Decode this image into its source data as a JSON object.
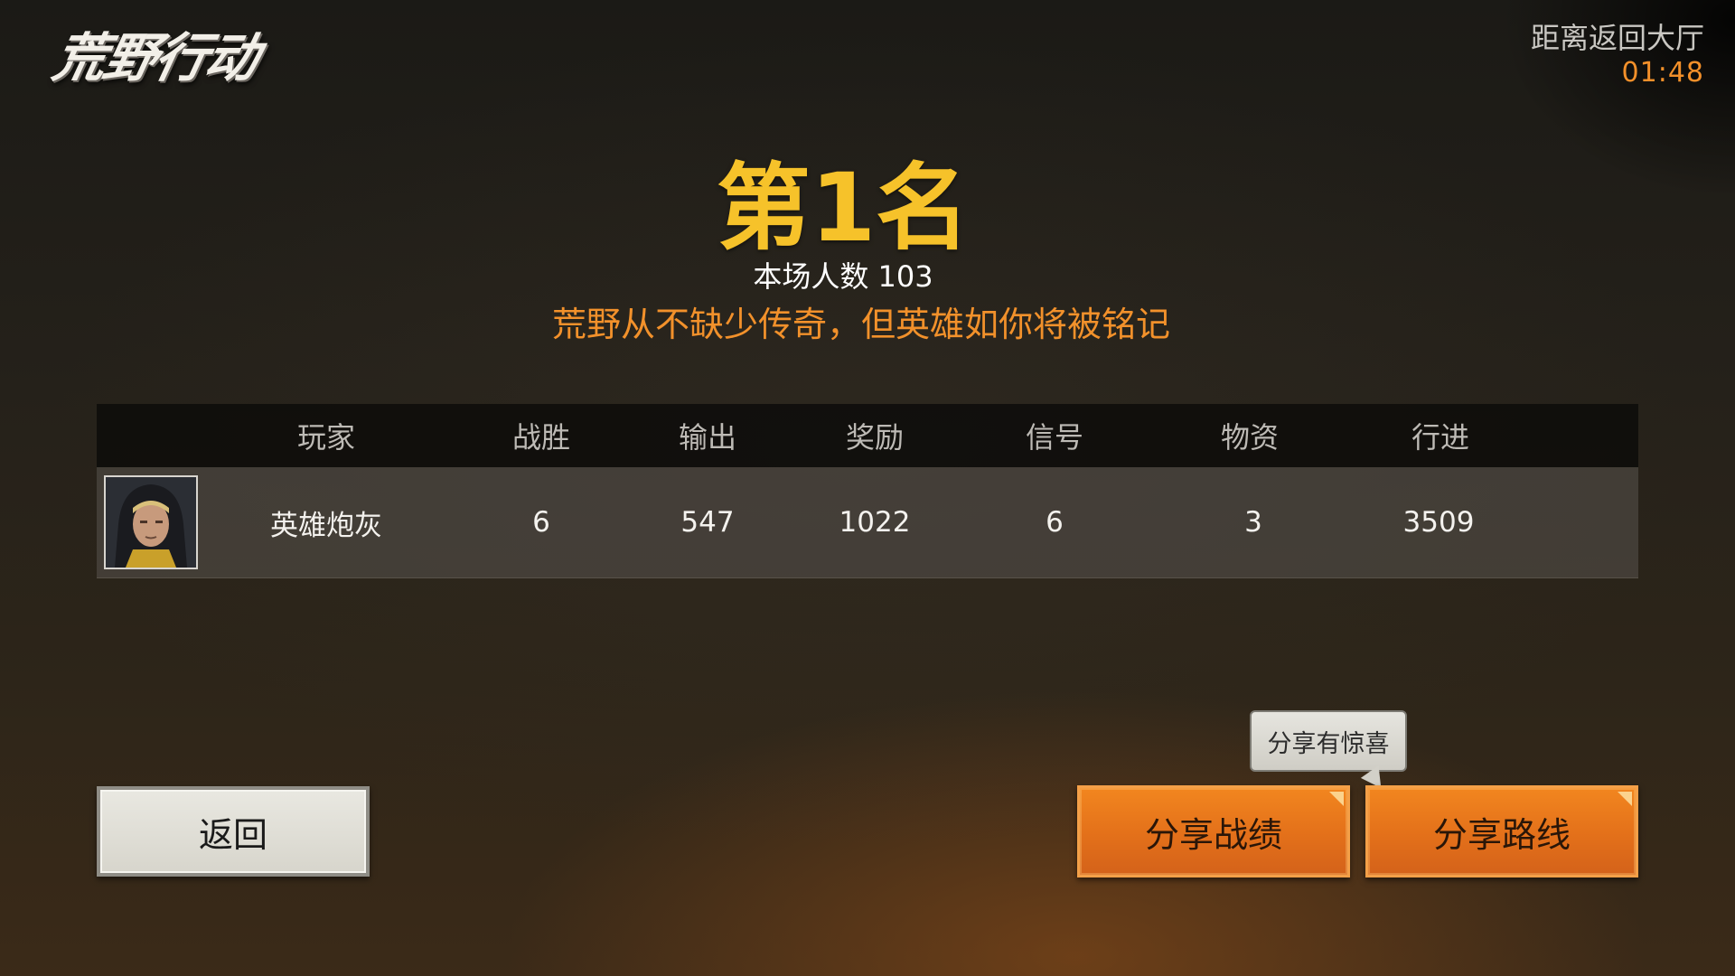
{
  "logo": {
    "text": "荒野行动"
  },
  "countdown": {
    "label": "距离返回大厅",
    "time": "01:48"
  },
  "result": {
    "rank": "第1名",
    "players_label": "本场人数 103",
    "motto": "荒野从不缺少传奇，但英雄如你将被铭记"
  },
  "table": {
    "headers": [
      "玩家",
      "战胜",
      "输出",
      "奖励",
      "信号",
      "物资",
      "行进"
    ],
    "rows": [
      {
        "player": "英雄炮灰",
        "wins": "6",
        "damage": "547",
        "reward": "1022",
        "signal": "6",
        "supplies": "3",
        "travel": "3509"
      }
    ]
  },
  "buttons": {
    "back": "返回",
    "share_record": "分享战绩",
    "share_route": "分享路线"
  },
  "tooltip": {
    "text": "分享有惊喜"
  },
  "colors": {
    "rank": "#f6c22a",
    "accent_orange": "#f2912b",
    "button_orange": "#e3701a"
  }
}
